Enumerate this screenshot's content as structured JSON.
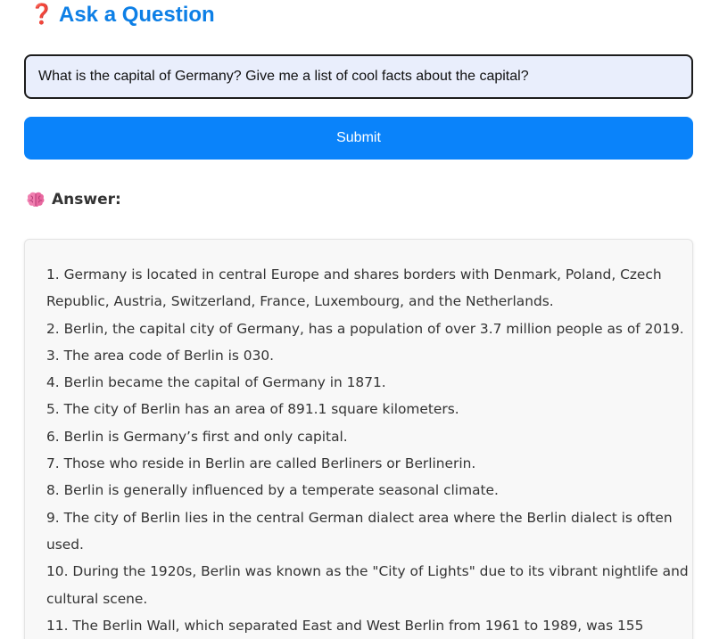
{
  "header": {
    "icon": "question-mark-icon",
    "icon_glyph": "❓",
    "icon_color": "#e0242f",
    "title": "Ask a Question",
    "title_color": "#0d7fe6"
  },
  "question": {
    "value": "What is the capital of Germany? Give me a list of cool facts about the capital?",
    "placeholder": ""
  },
  "submit": {
    "label": "Submit",
    "color": "#0a83fa"
  },
  "answer": {
    "icon": "brain-icon",
    "heading": "Answer:",
    "lines": [
      "1. Germany is located in central Europe and shares borders with Denmark, Poland, Czech",
      "Republic, Austria, Switzerland, France, Luxembourg, and the Netherlands.",
      "2. Berlin, the capital city of Germany, has a population of over 3.7 million people as of 2019.",
      "3. The area code of Berlin is 030.",
      "4. Berlin became the capital of Germany in 1871.",
      "5. The city of Berlin has an area of 891.1 square kilometers.",
      "6. Berlin is Germany’s first and only capital.",
      "7. Those who reside in Berlin are called Berliners or Berlinerin.",
      "8. Berlin is generally influenced by a temperate seasonal climate.",
      "9. The city of Berlin lies in the central German dialect area where the Berlin dialect is often",
      "used.",
      "10. During the 1920s, Berlin was known as the \"City of Lights\" due to its vibrant nightlife and",
      "cultural scene.",
      "11. The Berlin Wall, which separated East and West Berlin from 1961 to 1989, was 155"
    ]
  }
}
